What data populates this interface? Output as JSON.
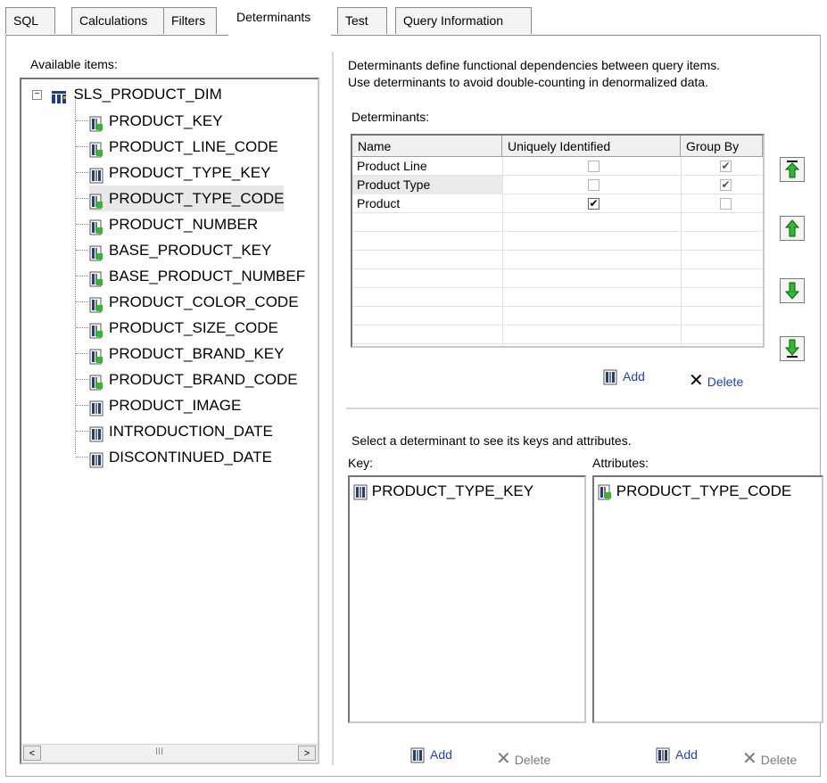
{
  "tabs": [
    {
      "label": "SQL"
    },
    {
      "label": "Calculations"
    },
    {
      "label": "Filters"
    },
    {
      "label": "Determinants"
    },
    {
      "label": "Test"
    },
    {
      "label": "Query Information"
    }
  ],
  "active_tab": "Determinants",
  "left": {
    "label": "Available items:",
    "root": "SLS_PRODUCT_DIM",
    "items": [
      {
        "label": "PRODUCT_KEY",
        "icon": "attribute-icon"
      },
      {
        "label": "PRODUCT_LINE_CODE",
        "icon": "attribute-icon"
      },
      {
        "label": "PRODUCT_TYPE_KEY",
        "icon": "measure-icon"
      },
      {
        "label": "PRODUCT_TYPE_CODE",
        "icon": "attribute-icon"
      },
      {
        "label": "PRODUCT_NUMBER",
        "icon": "attribute-icon"
      },
      {
        "label": "BASE_PRODUCT_KEY",
        "icon": "attribute-icon"
      },
      {
        "label": "BASE_PRODUCT_NUMBEF",
        "icon": "attribute-icon"
      },
      {
        "label": "PRODUCT_COLOR_CODE",
        "icon": "attribute-icon"
      },
      {
        "label": "PRODUCT_SIZE_CODE",
        "icon": "attribute-icon"
      },
      {
        "label": "PRODUCT_BRAND_KEY",
        "icon": "attribute-icon"
      },
      {
        "label": "PRODUCT_BRAND_CODE",
        "icon": "attribute-icon"
      },
      {
        "label": "PRODUCT_IMAGE",
        "icon": "measure-icon"
      },
      {
        "label": "INTRODUCTION_DATE",
        "icon": "measure-icon"
      },
      {
        "label": "DISCONTINUED_DATE",
        "icon": "measure-icon"
      }
    ],
    "scroll_thumb": "III"
  },
  "right": {
    "description_line1": "Determinants define functional dependencies between query items.",
    "description_line2": "Use determinants to avoid double-counting in denormalized data.",
    "determinants_label": "Determinants:",
    "columns": [
      "Name",
      "Uniquely Identified",
      "Group By"
    ],
    "rows": [
      {
        "name": "Product Line",
        "unique": false,
        "group_by": true
      },
      {
        "name": "Product Type",
        "unique": false,
        "group_by": true
      },
      {
        "name": "Product",
        "unique": true,
        "group_by": false
      }
    ],
    "add_label": "Add",
    "delete_label": "Delete",
    "hint": "Select a determinant to see its keys and attributes.",
    "key_label": "Key:",
    "attributes_label": "Attributes:",
    "key_items": [
      "PRODUCT_TYPE_KEY"
    ],
    "attribute_items": [
      "PRODUCT_TYPE_CODE"
    ]
  },
  "colors": {
    "link": "#1a3fd1",
    "arrow_green": "#2dbb2d",
    "disabled": "#7a7a7a"
  }
}
